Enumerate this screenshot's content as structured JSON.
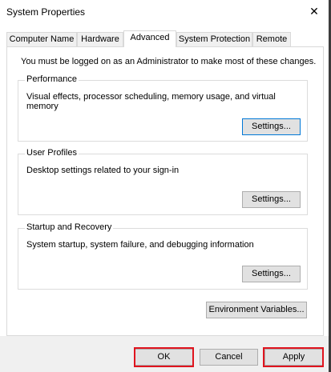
{
  "window": {
    "title": "System Properties",
    "close_glyph": "✕"
  },
  "tabs": [
    {
      "label": "Computer Name",
      "active": false
    },
    {
      "label": "Hardware",
      "active": false
    },
    {
      "label": "Advanced",
      "active": true
    },
    {
      "label": "System Protection",
      "active": false
    },
    {
      "label": "Remote",
      "active": false
    }
  ],
  "admin_note": "You must be logged on as an Administrator to make most of these changes.",
  "groups": {
    "performance": {
      "title": "Performance",
      "description": "Visual effects, processor scheduling, memory usage, and virtual memory",
      "button": "Settings..."
    },
    "user_profiles": {
      "title": "User Profiles",
      "description": "Desktop settings related to your sign-in",
      "button": "Settings..."
    },
    "startup_recovery": {
      "title": "Startup and Recovery",
      "description": "System startup, system failure, and debugging information",
      "button": "Settings..."
    }
  },
  "env_button": "Environment Variables...",
  "footer": {
    "ok": "OK",
    "cancel": "Cancel",
    "apply": "Apply"
  },
  "colors": {
    "highlight": "#e0141e",
    "focus_border": "#0078d7"
  }
}
